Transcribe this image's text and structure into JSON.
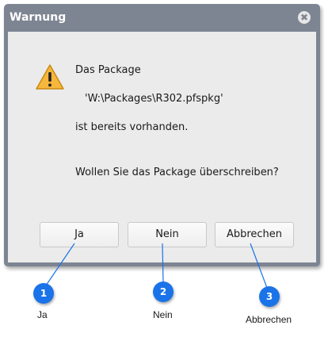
{
  "window": {
    "title": "Warnung",
    "close_glyph": "✖"
  },
  "message": {
    "line1": "Das Package",
    "line2": "'W:\\Packages\\R302.pfspkg'",
    "line3": "ist bereits vorhanden.",
    "line4": "Wollen Sie das Package überschreiben?"
  },
  "buttons": {
    "yes": "Ja",
    "no": "Nein",
    "cancel": "Abbrechen"
  },
  "callouts": [
    {
      "number": "1",
      "caption": "Ja"
    },
    {
      "number": "2",
      "caption": "Nein"
    },
    {
      "number": "3",
      "caption": "Abbrechen"
    }
  ],
  "colors": {
    "titlebar": "#7d8592",
    "content_bg": "#ebebeb",
    "badge": "#1a73e8",
    "warning_icon": "#f6b73c"
  }
}
